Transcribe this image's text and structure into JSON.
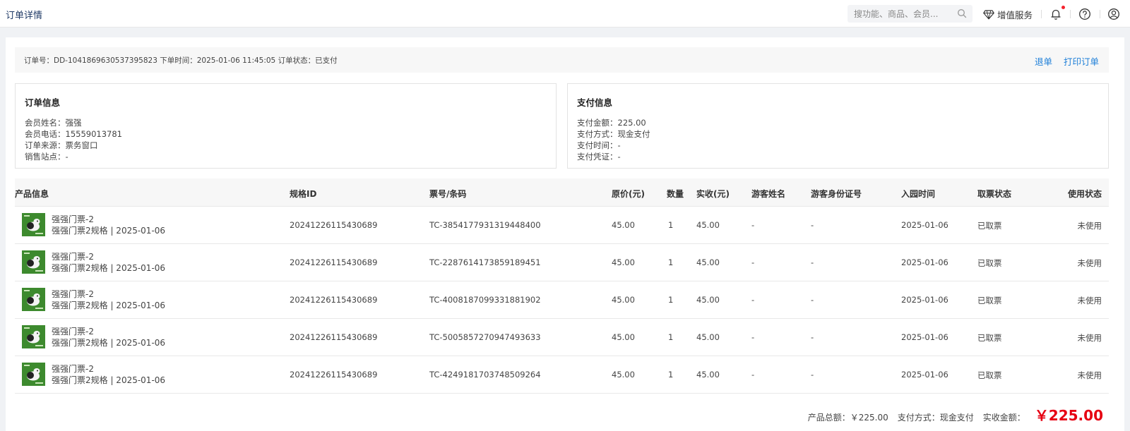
{
  "header": {
    "page_title": "订单详情",
    "search_placeholder": "搜功能、商品、会员...",
    "value_added_service": "增值服务"
  },
  "order": {
    "meta": "订单号：DD-1041869630537395823 下单时间：2025-01-06 11:45:05 订单状态：已支付",
    "refund_label": "退单",
    "print_label": "打印订单"
  },
  "order_info": {
    "title": "订单信息",
    "rows": [
      "会员姓名：强强",
      "会员电话：15559013781",
      "订单来源：票务窗口",
      "销售站点：-"
    ]
  },
  "payment_info": {
    "title": "支付信息",
    "rows": [
      "支付金额：225.00",
      "支付方式：现金支付",
      "支付时间：-",
      "支付凭证：-"
    ]
  },
  "table": {
    "headers": [
      "产品信息",
      "规格ID",
      "票号/条码",
      "原价(元)",
      "数量",
      "实收(元)",
      "游客姓名",
      "游客身份证号",
      "入园时间",
      "取票状态",
      "使用状态"
    ],
    "rows": [
      {
        "name": "强强门票-2",
        "spec": "强强门票2规格 | 2025-01-06",
        "spec_id": "20241226115430689",
        "ticket": "TC-3854177931319448400",
        "price": "45.00",
        "qty": "1",
        "paid": "45.00",
        "visitor": "-",
        "id_no": "-",
        "entry": "2025-01-06",
        "pickup": "已取票",
        "use": "未使用"
      },
      {
        "name": "强强门票-2",
        "spec": "强强门票2规格 | 2025-01-06",
        "spec_id": "20241226115430689",
        "ticket": "TC-2287614173859189451",
        "price": "45.00",
        "qty": "1",
        "paid": "45.00",
        "visitor": "-",
        "id_no": "-",
        "entry": "2025-01-06",
        "pickup": "已取票",
        "use": "未使用"
      },
      {
        "name": "强强门票-2",
        "spec": "强强门票2规格 | 2025-01-06",
        "spec_id": "20241226115430689",
        "ticket": "TC-4008187099331881902",
        "price": "45.00",
        "qty": "1",
        "paid": "45.00",
        "visitor": "-",
        "id_no": "-",
        "entry": "2025-01-06",
        "pickup": "已取票",
        "use": "未使用"
      },
      {
        "name": "强强门票-2",
        "spec": "强强门票2规格 | 2025-01-06",
        "spec_id": "20241226115430689",
        "ticket": "TC-5005857270947493633",
        "price": "45.00",
        "qty": "1",
        "paid": "45.00",
        "visitor": "-",
        "id_no": "-",
        "entry": "2025-01-06",
        "pickup": "已取票",
        "use": "未使用"
      },
      {
        "name": "强强门票-2",
        "spec": "强强门票2规格 | 2025-01-06",
        "spec_id": "20241226115430689",
        "ticket": "TC-4249181703748509264",
        "price": "45.00",
        "qty": "1",
        "paid": "45.00",
        "visitor": "-",
        "id_no": "-",
        "entry": "2025-01-06",
        "pickup": "已取票",
        "use": "未使用"
      }
    ]
  },
  "summary": {
    "product_total": "产品总额：￥225.00",
    "pay_method": "支付方式：现金支付",
    "received_label": "实收金额：",
    "received_value": "￥225.00"
  },
  "colors": {
    "link": "#1e7fd8",
    "total": "#e60012",
    "notification_dot": "#f5222d",
    "thumbnail": "#3d8a2e"
  },
  "icons": [
    "search-icon",
    "diamond-icon",
    "bell-icon",
    "help-icon",
    "user-icon"
  ]
}
